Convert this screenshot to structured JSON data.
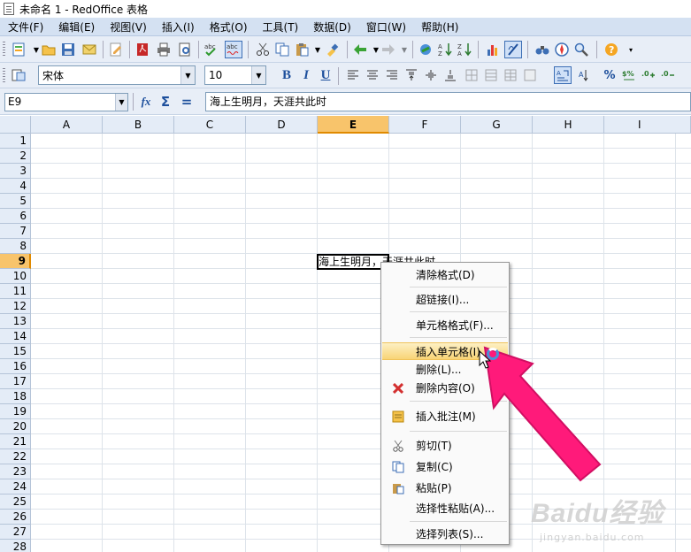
{
  "window": {
    "title": "未命名 1 - RedOffice 表格"
  },
  "menu": [
    "文件(F)",
    "编辑(E)",
    "视图(V)",
    "插入(I)",
    "格式(O)",
    "工具(T)",
    "数据(D)",
    "窗口(W)",
    "帮助(H)"
  ],
  "format": {
    "font_name": "宋体",
    "font_size": "10",
    "bold_label": "B",
    "italic_label": "I",
    "underline_label": "U"
  },
  "formula_bar": {
    "name_box": "E9",
    "formula": "海上生明月，天涯共此时"
  },
  "sheet": {
    "columns": [
      "A",
      "B",
      "C",
      "D",
      "E",
      "F",
      "G",
      "H",
      "I"
    ],
    "selected_column": "E",
    "rows": [
      "1",
      "2",
      "3",
      "4",
      "5",
      "6",
      "7",
      "8",
      "9",
      "10",
      "11",
      "12",
      "13",
      "14",
      "15",
      "16",
      "17",
      "18",
      "19",
      "20",
      "21",
      "22",
      "23",
      "24",
      "25",
      "26",
      "27",
      "28"
    ],
    "selected_row": "9",
    "active_cell": "E9",
    "cell_text": "海上生明月，天涯共此时"
  },
  "context_menu": {
    "items": [
      {
        "label": "清除格式(D)",
        "icon": ""
      },
      {
        "label": "超链接(I)...",
        "icon": ""
      },
      {
        "label": "单元格格式(F)...",
        "icon": ""
      },
      {
        "label": "插入单元格(I)...",
        "icon": ""
      },
      {
        "label": "删除(L)...",
        "icon": ""
      },
      {
        "label": "删除内容(O)",
        "icon": "red-x-icon"
      },
      {
        "label": "插入批注(M)",
        "icon": "note-icon"
      },
      {
        "label": "剪切(T)",
        "icon": "scissors-icon"
      },
      {
        "label": "复制(C)",
        "icon": "copy-icon"
      },
      {
        "label": "粘贴(P)",
        "icon": "paste-icon"
      },
      {
        "label": "选择性粘贴(A)...",
        "icon": ""
      },
      {
        "label": "选择列表(S)...",
        "icon": ""
      }
    ],
    "highlighted": "插入单元格(I)..."
  },
  "watermark": {
    "text": "Baidu经验",
    "url": "jingyan.baidu.com"
  },
  "colors": {
    "accent_arrow": "#ff1a7a",
    "selected_header": "#f8c46b",
    "menubar": "#d4e1f2"
  }
}
